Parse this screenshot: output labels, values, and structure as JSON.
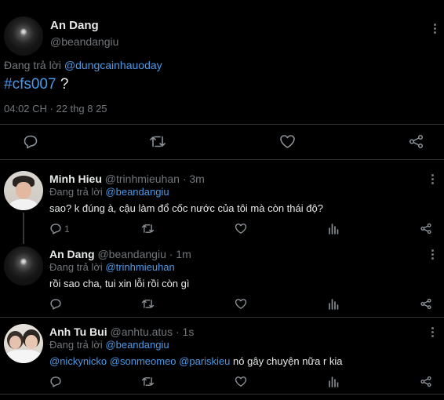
{
  "main_tweet": {
    "author_name": "An Dang",
    "author_handle": "@beandangiu",
    "reply_prefix": "Đang trả lời",
    "reply_to": "@dungcainhauoday",
    "hashtag": "#cfs007",
    "text_suffix": " ?",
    "timestamp": "04:02 CH · 22 thg 8 25"
  },
  "replies": [
    {
      "author_name": "Minh Hieu",
      "author_handle": "@trinhmieuhan",
      "time": "· 3m",
      "reply_prefix": "Đang trả lời",
      "reply_to": "@beandangiu",
      "text": "sao? k đúng à, cậu làm đổ cốc nước của tôi mà còn thái độ?",
      "reply_count": "1"
    },
    {
      "author_name": "An Dang",
      "author_handle": "@beandangiu",
      "time": "· 1m",
      "reply_prefix": "Đang trả lời",
      "reply_to": "@trinhmieuhan",
      "text": "rồi sao cha, tui xin lỗi rồi còn gì"
    },
    {
      "author_name": "Anh Tu Bui",
      "author_handle": "@anhtu.atus",
      "time": "· 1s",
      "reply_prefix": "Đang trả lời",
      "reply_to": "@beandangiu",
      "mentions": [
        "@nickynicko",
        "@sonmeomeo",
        "@pariskieu"
      ],
      "text": "nó gây chuyện nữa r kia"
    }
  ],
  "icons": [
    "reply-icon",
    "retweet-icon",
    "like-icon",
    "views-icon",
    "share-icon",
    "more-icon"
  ],
  "colors": {
    "background": "#000000",
    "text": "#e7e9ea",
    "muted": "#71767b",
    "link": "#4a99e9",
    "divider": "#2f3336"
  }
}
